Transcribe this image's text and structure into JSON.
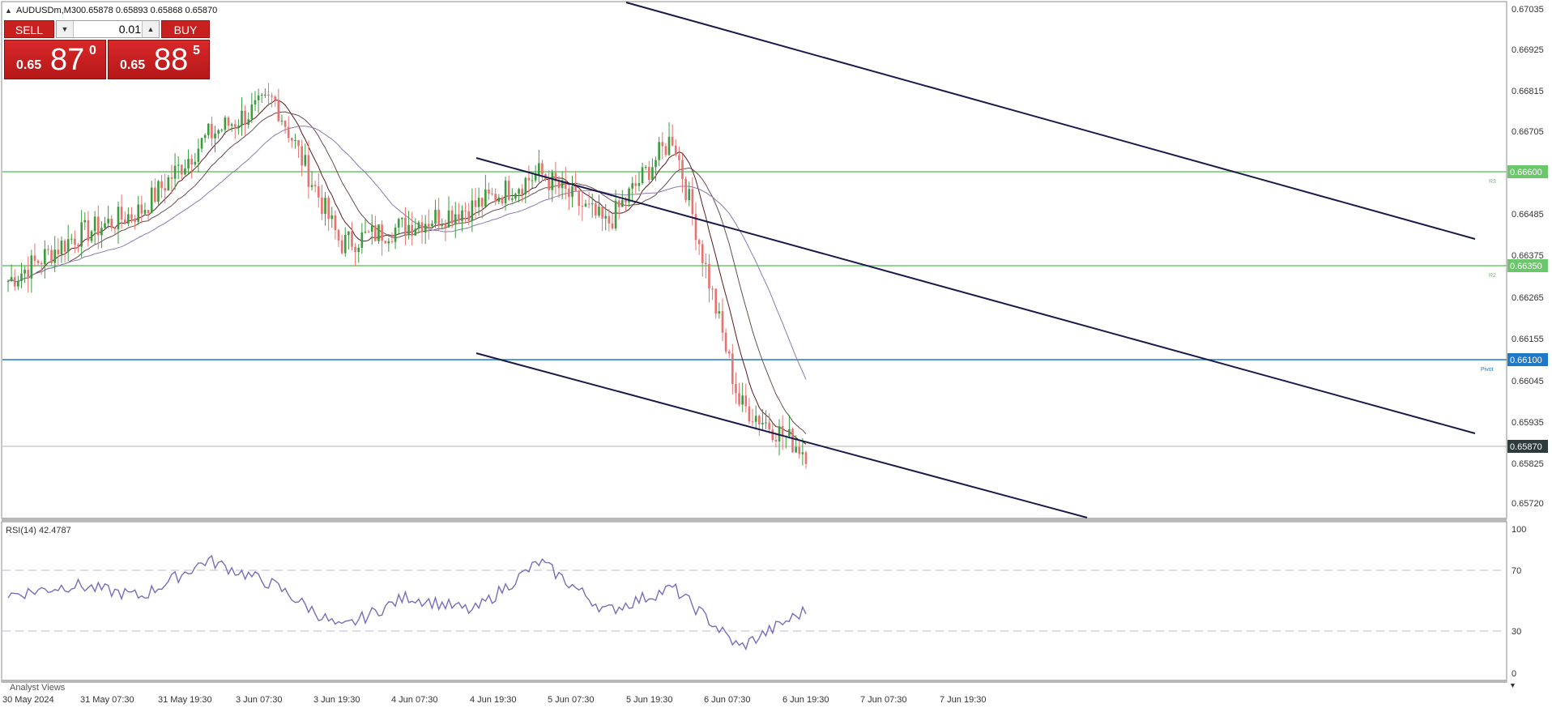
{
  "header": {
    "title": "AUDUSDm,M30",
    "ohlc": "0.65878 0.65893 0.65868 0.65870"
  },
  "trade_panel": {
    "sell_label": "SELL",
    "buy_label": "BUY",
    "lot": "0.01",
    "bid": {
      "prefix": "0.65",
      "big": "87",
      "small": "0"
    },
    "ask": {
      "prefix": "0.65",
      "big": "88",
      "small": "5"
    }
  },
  "icons": {
    "collapse": "triangle-up-icon",
    "lot_down": "chevron-down-icon",
    "lot_up": "chevron-up-icon",
    "scroll": "chevron-down-icon"
  },
  "colors": {
    "bull": "#3c9b3c",
    "bear": "#e8726f",
    "level": "#6cc76c",
    "pivot": "#1f78c8",
    "channel": "#1a1a4a",
    "rsi": "#7a6cb8",
    "price_tag": "#2e3b3b"
  },
  "price_axis": {
    "ticks": [
      "0.67035",
      "0.66925",
      "0.66815",
      "0.66705",
      "0.66485",
      "0.66375",
      "0.66265",
      "0.66155",
      "0.66045",
      "0.65935",
      "0.65825",
      "0.65720"
    ]
  },
  "levels": [
    {
      "label": "R3",
      "price": 0.666,
      "tag": "0.66600"
    },
    {
      "label": "R2",
      "price": 0.6635,
      "tag": "0.66350"
    },
    {
      "label": "Pivot",
      "price": 0.661,
      "tag": "0.66100"
    }
  ],
  "current_price": "0.65870",
  "time_axis": [
    "30 May 2024",
    "31 May 07:30",
    "31 May 19:30",
    "3 Jun 07:30",
    "3 Jun 19:30",
    "4 Jun 07:30",
    "4 Jun 19:30",
    "5 Jun 07:30",
    "5 Jun 19:30",
    "6 Jun 07:30",
    "6 Jun 19:30",
    "7 Jun 07:30",
    "7 Jun 19:30"
  ],
  "rsi": {
    "label": "RSI(14) 42.4787",
    "ticks": [
      "100",
      "70",
      "30",
      "0"
    ],
    "levels": [
      70,
      30
    ]
  },
  "bottom_tab": "Analyst Views",
  "chart_data": {
    "type": "candlestick",
    "title": "AUDUSDm,M30",
    "x": [
      "30 May 2024",
      "31 May 07:30",
      "31 May 19:30",
      "3 Jun 07:30",
      "3 Jun 19:30",
      "4 Jun 07:30",
      "4 Jun 19:30",
      "5 Jun 07:30",
      "5 Jun 19:30",
      "6 Jun 07:30",
      "6 Jun 19:30",
      "7 Jun 07:30",
      "7 Jun 19:30"
    ],
    "ylim": [
      0.65695,
      0.6708
    ],
    "close_approx": [
      0.6633,
      0.6645,
      0.6652,
      0.6672,
      0.6682,
      0.6643,
      0.6648,
      0.6653,
      0.6662,
      0.6648,
      0.6672,
      0.66,
      0.6587
    ],
    "horizontal_levels": [
      0.666,
      0.6635,
      0.661
    ],
    "last_price": 0.6587,
    "rsi_series_approx": [
      53,
      60,
      52,
      77,
      60,
      30,
      52,
      42,
      76,
      42,
      58,
      17,
      42.4787
    ],
    "rsi_ylim": [
      0,
      100
    ],
    "grid": false,
    "legend": "none"
  }
}
